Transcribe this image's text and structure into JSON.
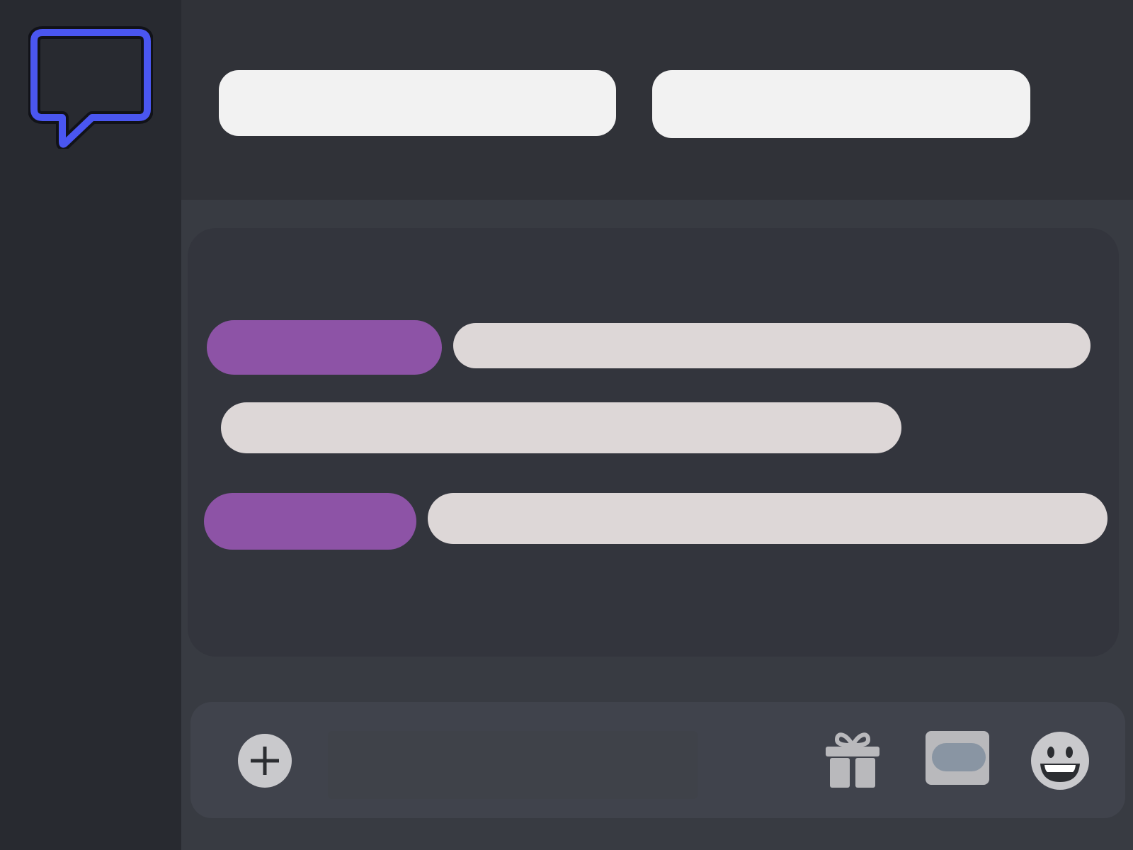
{
  "app": {
    "accent_color": "#4a56f0",
    "sidebar_color": "#282a30",
    "header_color": "#303238",
    "chat_bg_color": "#33353d",
    "name_color": "#8d53a6",
    "message_color": "#ddd7d7"
  },
  "sidebar": {
    "logo_icon": "chat-bubble-icon"
  },
  "header": {
    "fields": [
      {
        "label": ""
      },
      {
        "label": ""
      }
    ]
  },
  "chat": {
    "messages": [
      {
        "author": "",
        "text": ""
      },
      {
        "author": "",
        "text": ""
      },
      {
        "author": "",
        "text": ""
      }
    ]
  },
  "composer": {
    "placeholder": "",
    "add_icon": "plus-circle-icon",
    "gift_icon": "gift-icon",
    "gif_icon": "gif-sticker-icon",
    "emoji_icon": "emoji-smile-icon"
  }
}
